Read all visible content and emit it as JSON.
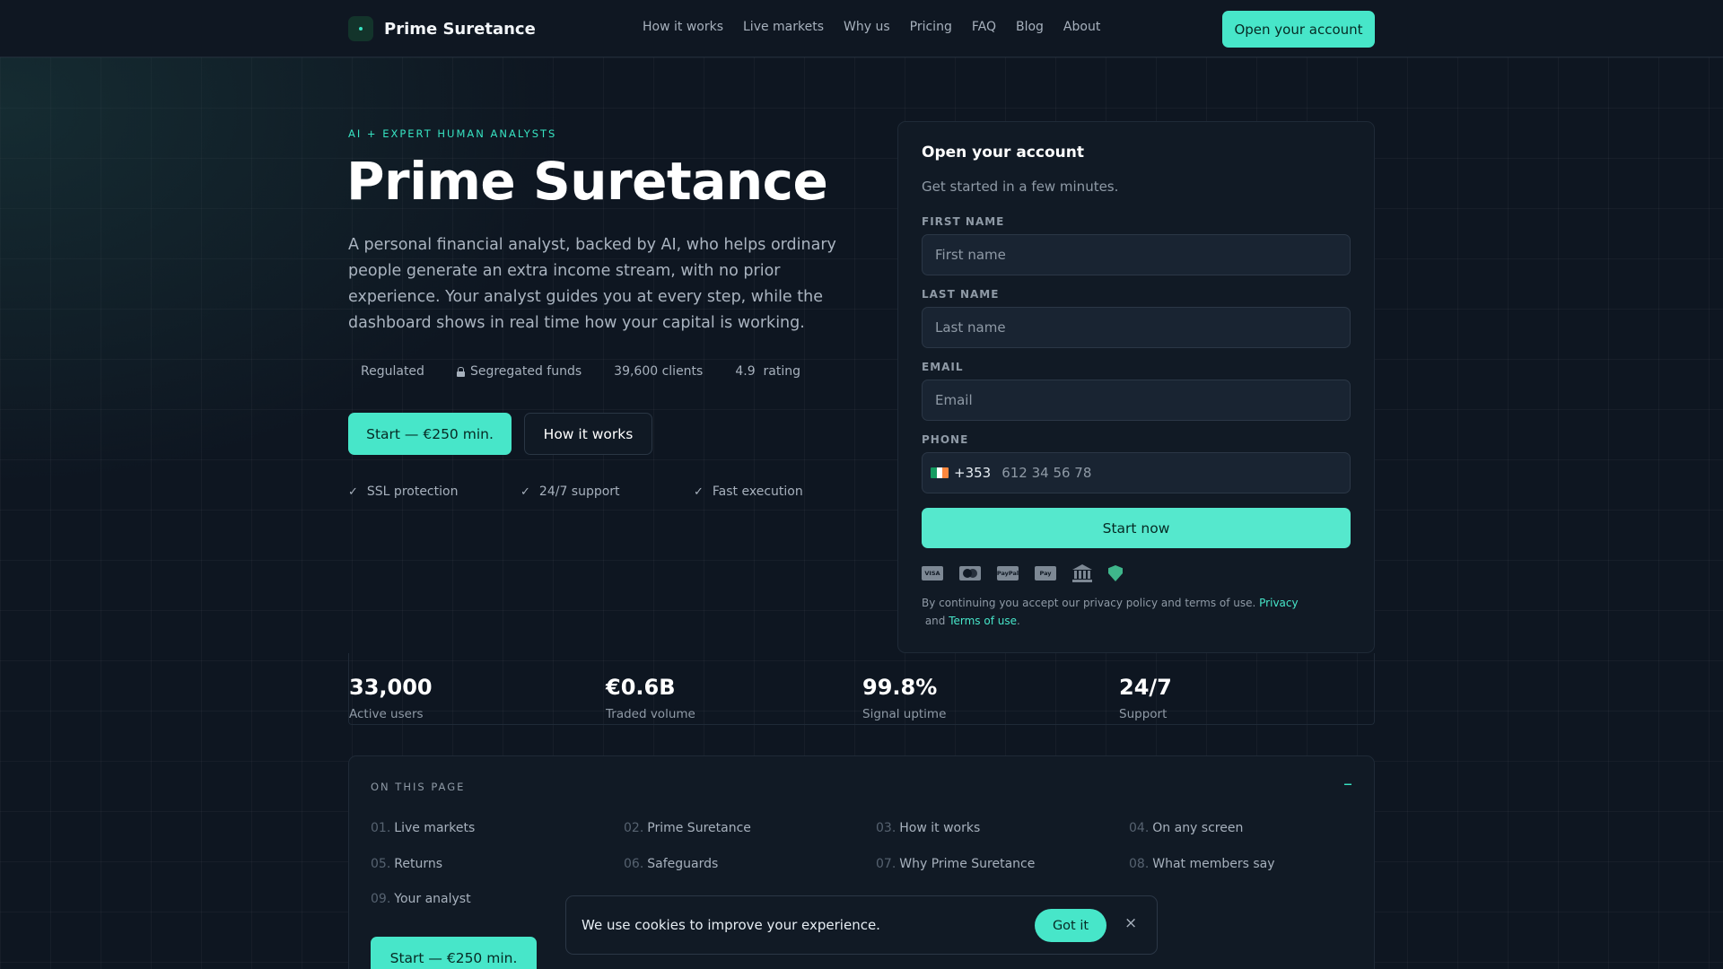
{
  "nav": {
    "brand": "Prime Suretance",
    "links": [
      "How it works",
      "Live markets",
      "Why us",
      "Pricing",
      "FAQ",
      "Blog",
      "About"
    ],
    "cta": "Open your account"
  },
  "hero": {
    "eyebrow": "AI + EXPERT HUMAN ANALYSTS",
    "title": "Prime Suretance",
    "description": "A personal financial analyst, backed by AI, who helps ordinary people generate an extra income stream, with no prior experience. Your analyst guides you at every step, while the dashboard shows in real time how your capital is working.",
    "trust": [
      "Regulated",
      "Segregated funds",
      "39,600 clients",
      "4.9  rating"
    ],
    "primary_button": "Start — €250 min.",
    "secondary_button": "How it works",
    "features": [
      "SSL protection",
      "24/7 support",
      "Fast execution"
    ]
  },
  "form": {
    "title": "Open your account",
    "subtitle": "Get started in a few minutes.",
    "first_name_label": "FIRST NAME",
    "first_name_placeholder": "First name",
    "last_name_label": "LAST NAME",
    "last_name_placeholder": "Last name",
    "email_label": "EMAIL",
    "email_placeholder": "Email",
    "phone_label": "PHONE",
    "dial_code": "+353",
    "phone_placeholder": "612 34 56 78",
    "submit": "Start now",
    "payment_icons": [
      "visa-icon",
      "mastercard-icon",
      "paypal-icon",
      "apple-pay-icon",
      "bank-icon",
      "shield-icon"
    ],
    "legal_text": "By continuing you accept our privacy policy and terms of use. ",
    "privacy_link": "Privacy",
    "legal_and": " and ",
    "terms_link": "Terms of use",
    "legal_end": "."
  },
  "stats": [
    {
      "value": "33,000",
      "label": "Active users"
    },
    {
      "value": "€0.6B",
      "label": "Traded volume"
    },
    {
      "value": "99.8%",
      "label": "Signal uptime"
    },
    {
      "value": "24/7",
      "label": "Support"
    }
  ],
  "toc": {
    "title": "ON THIS PAGE",
    "collapse_symbol": "–",
    "items": [
      {
        "num": "01.",
        "label": "Live markets"
      },
      {
        "num": "02.",
        "label": "Prime Suretance"
      },
      {
        "num": "03.",
        "label": "How it works"
      },
      {
        "num": "04.",
        "label": "On any screen"
      },
      {
        "num": "05.",
        "label": "Returns"
      },
      {
        "num": "06.",
        "label": "Safeguards"
      },
      {
        "num": "07.",
        "label": "Why Prime Suretance"
      },
      {
        "num": "08.",
        "label": "What members say"
      },
      {
        "num": "09.",
        "label": "Your analyst"
      }
    ],
    "button": "Start — €250 min."
  },
  "cookie": {
    "text": "We use cookies to improve your experience.",
    "accept": "Got it",
    "close": "×"
  },
  "colors": {
    "accent": "#47e6c9",
    "background": "#0e1621",
    "card": "#111a25",
    "flag": [
      "#169b62",
      "#ffffff",
      "#ff883e"
    ]
  }
}
